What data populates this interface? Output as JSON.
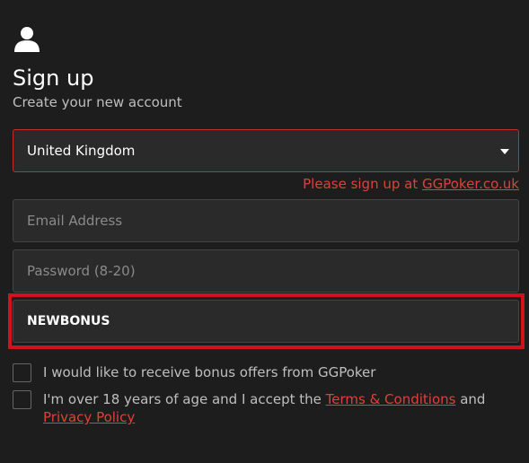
{
  "header": {
    "icon": "user-icon",
    "title": "Sign up",
    "subtitle": "Create your new account"
  },
  "form": {
    "country_value": "United Kingdom",
    "country_warning_prefix": "Please sign up at ",
    "country_warning_link": "GGPoker.co.uk",
    "email_placeholder": "Email Address",
    "password_placeholder": "Password (8-20)",
    "promo_value": "NEWBONUS",
    "bonus_checkbox_label": "I would like to receive bonus offers from GGPoker",
    "age_checkbox_prefix": "I'm over 18 years of age and I accept the ",
    "terms_link": "Terms & Conditions",
    "age_checkbox_and": " and ",
    "privacy_link": "Privacy Policy"
  },
  "colors": {
    "background": "#1d1d1d",
    "error_red": "#e0403a",
    "highlight_red": "#d0121b"
  }
}
